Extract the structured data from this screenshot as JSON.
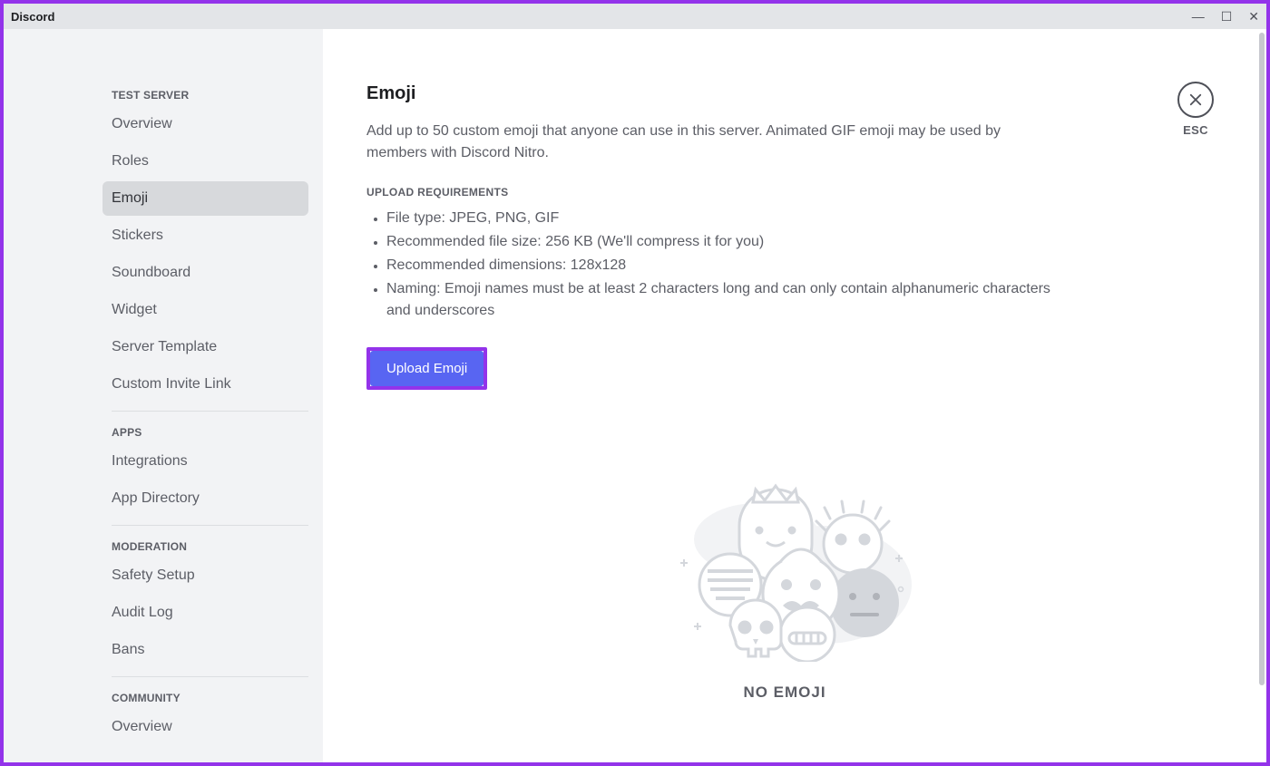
{
  "window": {
    "title": "Discord"
  },
  "sidebar": {
    "sections": [
      {
        "heading": "TEST SERVER",
        "items": [
          {
            "label": "Overview",
            "active": false
          },
          {
            "label": "Roles",
            "active": false
          },
          {
            "label": "Emoji",
            "active": true
          },
          {
            "label": "Stickers",
            "active": false
          },
          {
            "label": "Soundboard",
            "active": false
          },
          {
            "label": "Widget",
            "active": false
          },
          {
            "label": "Server Template",
            "active": false
          },
          {
            "label": "Custom Invite Link",
            "active": false
          }
        ]
      },
      {
        "heading": "APPS",
        "items": [
          {
            "label": "Integrations",
            "active": false
          },
          {
            "label": "App Directory",
            "active": false
          }
        ]
      },
      {
        "heading": "MODERATION",
        "items": [
          {
            "label": "Safety Setup",
            "active": false
          },
          {
            "label": "Audit Log",
            "active": false
          },
          {
            "label": "Bans",
            "active": false
          }
        ]
      },
      {
        "heading": "COMMUNITY",
        "items": [
          {
            "label": "Overview",
            "active": false
          }
        ]
      }
    ]
  },
  "main": {
    "title": "Emoji",
    "description": "Add up to 50 custom emoji that anyone can use in this server. Animated GIF emoji may be used by members with Discord Nitro.",
    "requirements_heading": "UPLOAD REQUIREMENTS",
    "requirements": [
      "File type: JPEG, PNG, GIF",
      "Recommended file size: 256 KB (We'll compress it for you)",
      "Recommended dimensions: 128x128",
      "Naming: Emoji names must be at least 2 characters long and can only contain alphanumeric characters and underscores"
    ],
    "upload_button": "Upload Emoji",
    "empty_title": "NO EMOJI"
  },
  "close": {
    "label": "ESC"
  }
}
